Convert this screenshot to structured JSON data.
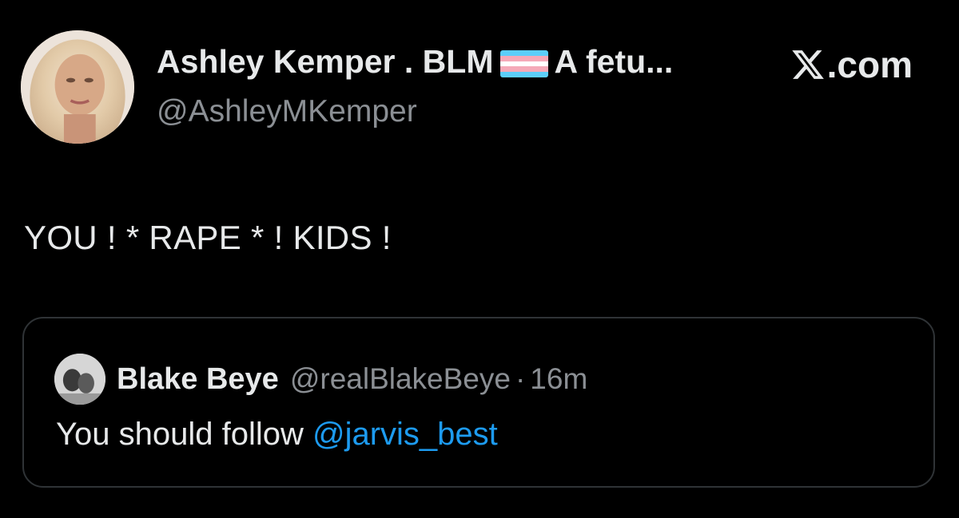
{
  "author": {
    "display_name_part1": "Ashley Kemper . BLM",
    "display_name_part2": "A fetu...",
    "handle": "@AshleyMKemper",
    "flag_icon": "transgender-flag-emoji"
  },
  "brand": {
    "text": ".com",
    "icon": "x-logo-icon"
  },
  "tweet": {
    "text": "YOU ! * RAPE * ! KIDS !"
  },
  "quote": {
    "name": "Blake Beye",
    "handle": "@realBlakeBeye",
    "separator": "·",
    "time": "16m",
    "text_prefix": "You should follow ",
    "mention": "@jarvis_best"
  },
  "colors": {
    "background": "#000000",
    "primary_text": "#e7e9ea",
    "secondary_text": "#8b8f94",
    "link": "#1d9bf0",
    "border": "#2f3336",
    "flag_blue": "#5BCEFA",
    "flag_pink": "#F5A9B8",
    "flag_white": "#FFFFFF"
  }
}
